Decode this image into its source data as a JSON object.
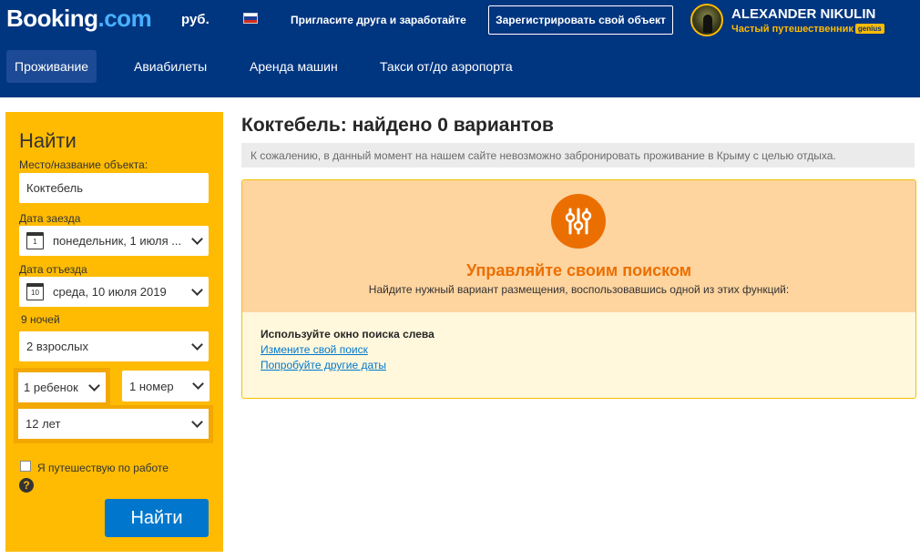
{
  "header": {
    "logo_main": "Booking",
    "logo_suffix": ".com",
    "currency": "руб.",
    "invite_text": "Пригласите друга и заработайте",
    "register_button": "Зарегистрировать свой объект",
    "user": {
      "name": "ALEXANDER NIKULIN",
      "level": "Частый путешественник",
      "badge": "genius"
    },
    "nav": [
      {
        "label": "Проживание",
        "active": true
      },
      {
        "label": "Авиабилеты",
        "active": false
      },
      {
        "label": "Аренда машин",
        "active": false
      },
      {
        "label": "Такси от/до аэропорта",
        "active": false
      }
    ]
  },
  "sidebar": {
    "title": "Найти",
    "destination_label": "Место/название объекта:",
    "destination_value": "Коктебель",
    "checkin_label": "Дата заезда",
    "checkin_value": "понедельник, 1 июля ...",
    "checkin_day": "1",
    "checkout_label": "Дата отъезда",
    "checkout_value": "среда, 10 июля 2019",
    "checkout_day": "10",
    "nights": "9 ночей",
    "adults": "2 взрослых",
    "children": "1 ребенок",
    "rooms": "1 номер",
    "child_age": "12 лет",
    "business_trip": "Я путешествую по работе",
    "help_symbol": "?",
    "search_button": "Найти"
  },
  "main": {
    "title": "Коктебель: найдено 0 вариантов",
    "notice": "К сожалению, в данный момент на нашем сайте невозможно забронировать проживание в Крыму с целью отдыха.",
    "manage": {
      "title": "Управляйте своим поиском",
      "subtitle": "Найдите нужный вариант размещения, воспользовавшись одной из этих функций:",
      "tips_title": "Используйте окно поиска слева",
      "links": [
        "Измените свой поиск",
        "Попробуйте другие даты"
      ]
    }
  },
  "colors": {
    "header_bg": "#003580",
    "sidebar_bg": "#febb02",
    "accent_orange": "#eb6f00",
    "link_blue": "#0077cc"
  }
}
